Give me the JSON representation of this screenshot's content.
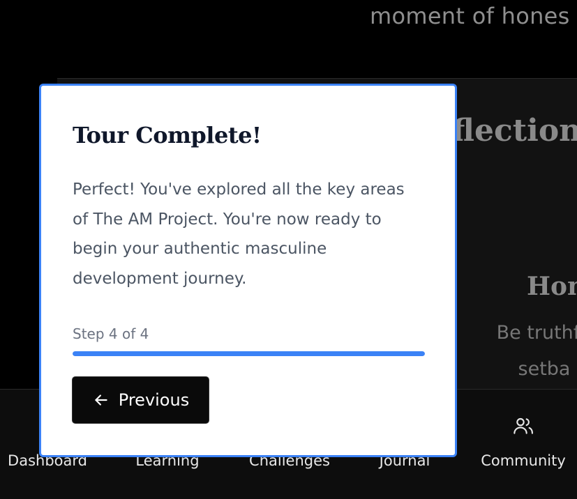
{
  "background": {
    "quote_fragment": "moment of hones",
    "section_heading_fragment": "flections",
    "card_heading_fragment": "Hon",
    "card_text_fragment": "Be truthfu\nsetba"
  },
  "modal": {
    "title": "Tour Complete!",
    "body": "Perfect! You've explored all the key areas of The AM Project. You're now ready to begin your authentic masculine development journey.",
    "step_label": "Step 4 of 4",
    "progress": 1.0,
    "previous_label": "Previous",
    "accent_color": "#3b82f6"
  },
  "bottom_nav": {
    "items": [
      {
        "label": "Dashboard",
        "icon": "dashboard-icon"
      },
      {
        "label": "Learning",
        "icon": "book-icon"
      },
      {
        "label": "Challenges",
        "icon": "target-icon"
      },
      {
        "label": "Journal",
        "icon": "journal-icon"
      },
      {
        "label": "Community",
        "icon": "users-icon"
      }
    ]
  }
}
